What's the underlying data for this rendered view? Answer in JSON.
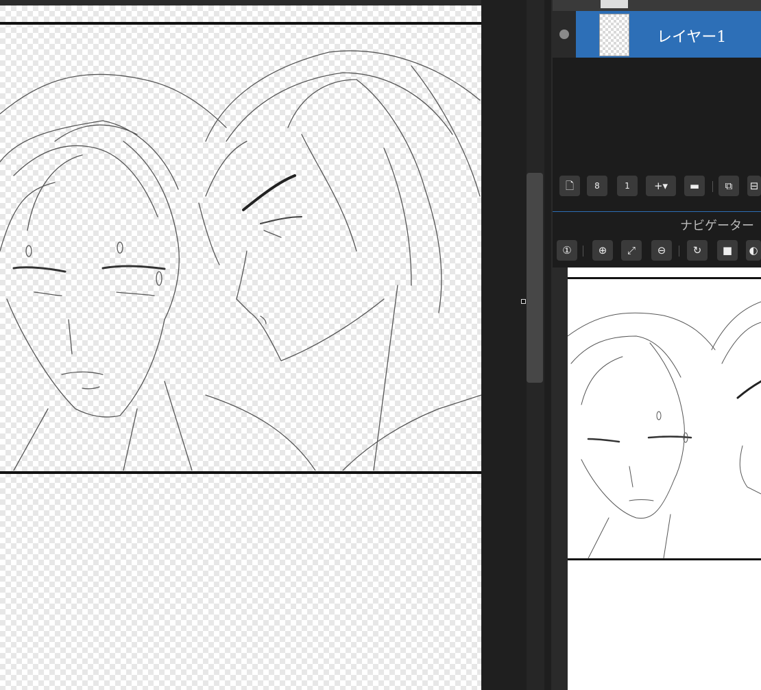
{
  "layers": {
    "active_layer_name": "レイヤー1"
  },
  "navigator": {
    "title": "ナビゲーター"
  },
  "layer_toolbar": {
    "buttons": [
      "new-layer",
      "new-layer-8bit",
      "new-layer-1bit",
      "add-layer-dropdown",
      "folder",
      "duplicate",
      "merge"
    ]
  },
  "navigator_toolbar": {
    "buttons": [
      "actual-size",
      "zoom-in",
      "fit",
      "zoom-out",
      "rotate",
      "fullscreen",
      "reset-rotation"
    ]
  }
}
